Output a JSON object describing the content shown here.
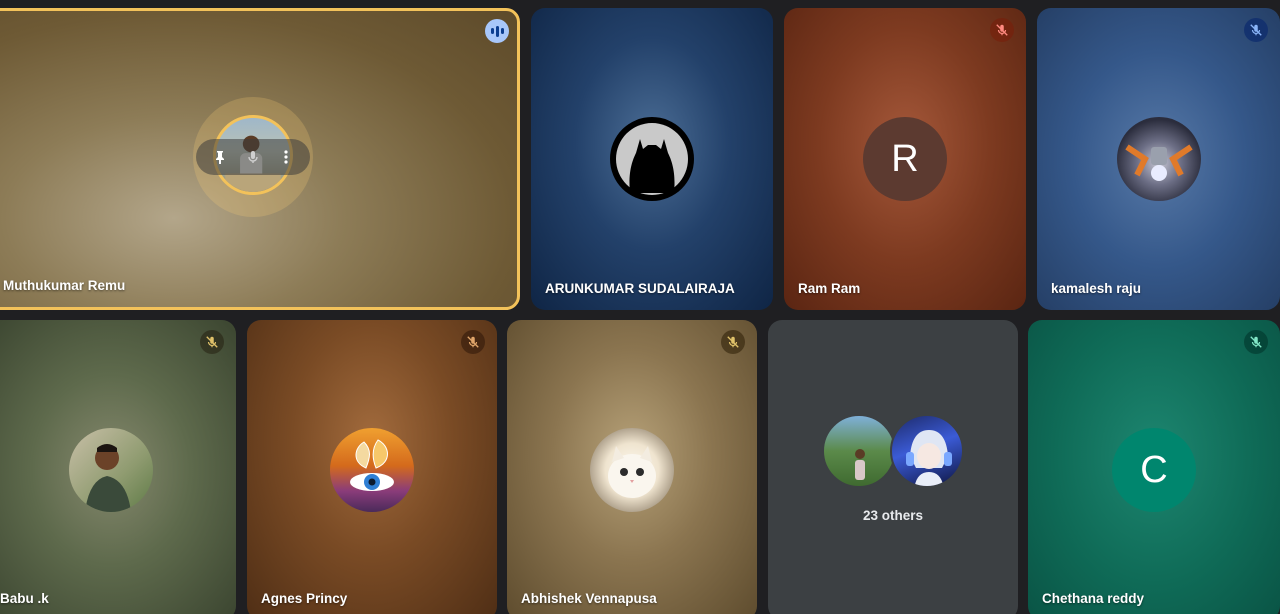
{
  "participants": [
    {
      "id": "t1",
      "name": "Muthukumar Remu",
      "speaking": true,
      "avatar_type": "photo"
    },
    {
      "id": "t2",
      "name": "ARUNKUMAR SUDALAIRAJA",
      "muted": false,
      "avatar_type": "batman-icon"
    },
    {
      "id": "t3",
      "name": "Ram Ram",
      "muted": true,
      "avatar_letter": "R"
    },
    {
      "id": "t4",
      "name": "kamalesh raju",
      "muted": true,
      "avatar_type": "photo"
    },
    {
      "id": "t5",
      "name": "Babu .k",
      "muted": true,
      "avatar_type": "photo"
    },
    {
      "id": "t6",
      "name": "Agnes Princy",
      "muted": true,
      "avatar_type": "photo"
    },
    {
      "id": "t7",
      "name": "Abhishek Vennapusa",
      "muted": true,
      "avatar_type": "photo"
    },
    {
      "id": "t9",
      "name": "Chethana reddy",
      "muted": true,
      "avatar_letter": "C"
    }
  ],
  "others": {
    "label": "23 others"
  },
  "colors": {
    "highlight_border": "#f3c25a",
    "speaking_badge": "#a8c7fa"
  }
}
